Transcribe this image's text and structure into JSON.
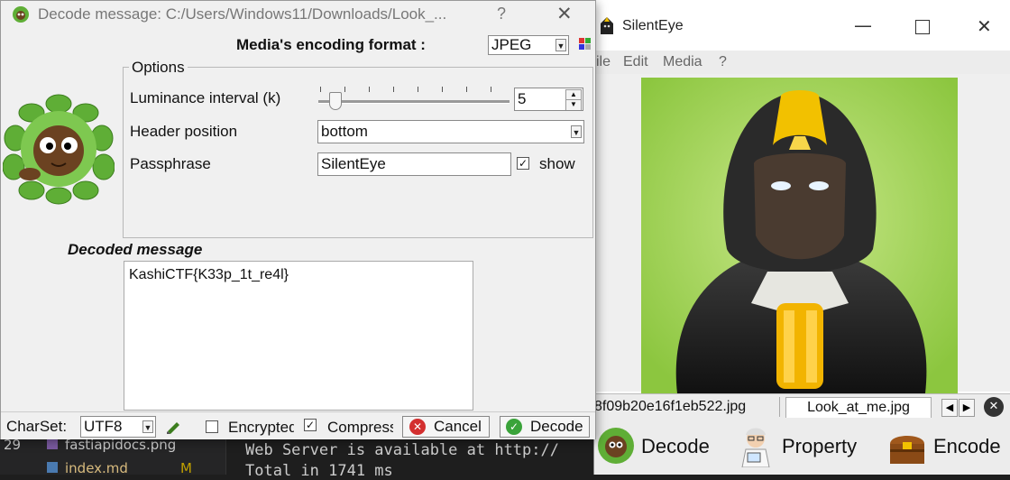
{
  "background": {
    "explorer_files": [
      {
        "name": "fastiapidocs.png",
        "badge": ""
      },
      {
        "name": "index.md",
        "badge": "M"
      }
    ],
    "line_numbers": [
      "29"
    ],
    "terminal_lines": [
      "Web Server is available at http://",
      "Total in 1741 ms"
    ]
  },
  "silenteye": {
    "title": "SilentEye",
    "menu": [
      "ile",
      "Edit",
      "Media",
      "?"
    ],
    "tabs": [
      "8f09b20e16f1eb522.jpg",
      "Look_at_me.jpg"
    ],
    "buttons": {
      "decode": "Decode",
      "property": "Property",
      "encode": "Encode"
    }
  },
  "dialog": {
    "title": "Decode message: C:/Users/Windows11/Downloads/Look_...",
    "help_button": "?",
    "close_button": "✕",
    "format_label": "Media's encoding format :",
    "format_value": "JPEG",
    "options": {
      "legend": "Options",
      "luminance_label": "Luminance interval (k)",
      "luminance_value": "5",
      "luminance_slider_fraction": 0.05,
      "header_label": "Header position",
      "header_value": "bottom",
      "passphrase_label": "Passphrase",
      "passphrase_value": "SilentEye",
      "show_label": "show",
      "show_checked": true
    },
    "decoded_label": "Decoded message",
    "decoded_text": "KashiCTF{K33p_1t_re4l}",
    "footer": {
      "charset_label": "CharSet:",
      "charset_value": "UTF8",
      "encrypted_label": "Encrypted",
      "encrypted_checked": false,
      "compressed_label": "Compressed",
      "compressed_checked": true,
      "cancel_label": "Cancel",
      "decode_label": "Decode"
    }
  },
  "colors": {
    "accent_red": "#d32f2f",
    "accent_green": "#3aa33a",
    "terminal_bg": "#1e1e1e"
  }
}
